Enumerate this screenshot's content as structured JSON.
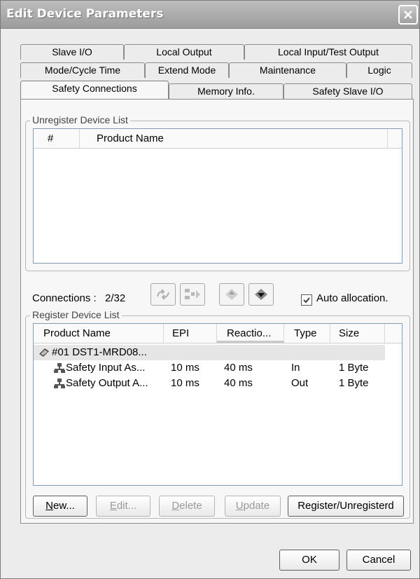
{
  "window": {
    "title": "Edit Device Parameters"
  },
  "tabs": {
    "row1": [
      "Slave I/O",
      "Local Output",
      "Local Input/Test Output"
    ],
    "row2": [
      "Mode/Cycle Time",
      "Extend Mode",
      "Maintenance",
      "Logic"
    ],
    "row3": [
      "Safety Connections",
      "Memory Info.",
      "Safety Slave I/O"
    ]
  },
  "unregister": {
    "legend": "Unregister Device List",
    "columns": [
      "#",
      "Product Name"
    ]
  },
  "connections": {
    "label": "Connections :",
    "value": "2/32",
    "tool_icons": [
      "auto-arrange-icon",
      "network-nodes-icon",
      "diamond-up-icon",
      "diamond-down-icon"
    ],
    "auto_allocation": {
      "label": "Auto allocation.",
      "checked": true
    }
  },
  "register": {
    "legend": "Register Device List",
    "columns": [
      "Product Name",
      "EPI",
      "Reactio...",
      "Type",
      "Size"
    ],
    "device": {
      "name": "#01 DST1-MRD08..."
    },
    "rows": [
      {
        "name": "Safety Input As...",
        "epi": "10 ms",
        "reaction": "40 ms",
        "type": "In",
        "size": "1 Byte"
      },
      {
        "name": "Safety Output A...",
        "epi": "10 ms",
        "reaction": "40 ms",
        "type": "Out",
        "size": "1 Byte"
      }
    ]
  },
  "buttons": {
    "new": {
      "mnemonic": "N",
      "rest": "ew..."
    },
    "edit": {
      "mnemonic": "E",
      "rest": "dit..."
    },
    "delete": {
      "mnemonic": "D",
      "rest": "elete"
    },
    "update": {
      "mnemonic": "U",
      "rest": "pdate"
    },
    "register": "Register/Unregisterd",
    "ok": "OK",
    "cancel": "Cancel"
  }
}
